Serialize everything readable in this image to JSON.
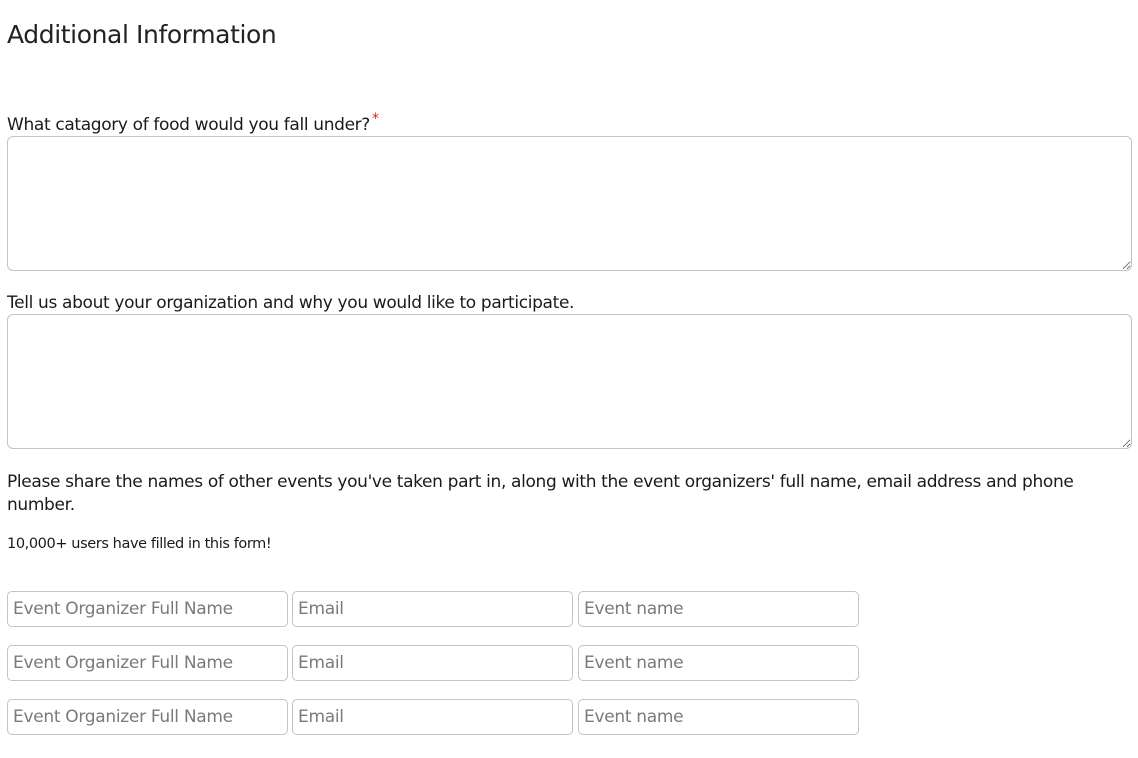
{
  "section": {
    "title": "Additional Information"
  },
  "fields": {
    "food_category": {
      "label": "What catagory of food would you fall under?",
      "required_mark": "*",
      "value": ""
    },
    "organization": {
      "label": "Tell us about your organization and why you would like to participate.",
      "value": ""
    }
  },
  "events": {
    "prompt": "Please share the names of other events you've taken part in, along with the event organizers' full name, email address and phone number.",
    "users_note": "10,000+ users have filled in this form!",
    "rows": [
      {
        "name_placeholder": "Event Organizer Full Name",
        "email_placeholder": "Email",
        "event_placeholder": "Event name"
      },
      {
        "name_placeholder": "Event Organizer Full Name",
        "email_placeholder": "Email",
        "event_placeholder": "Event name"
      },
      {
        "name_placeholder": "Event Organizer Full Name",
        "email_placeholder": "Email",
        "event_placeholder": "Event name"
      }
    ]
  },
  "colors": {
    "required": "#e0201b",
    "border": "#c4c4c4",
    "placeholder": "#7a7a7a",
    "text": "#1a1a1a"
  }
}
